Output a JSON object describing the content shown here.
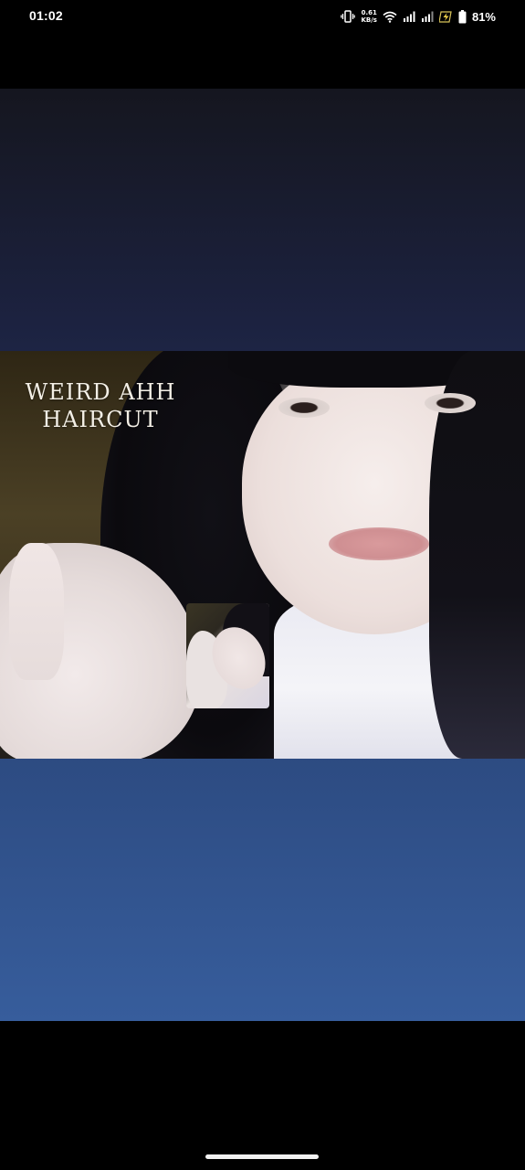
{
  "status_bar": {
    "time": "01:02",
    "net_speed_value": "0.61",
    "net_speed_unit": "KB/s",
    "battery_percent": "81%",
    "icons": [
      "vibrate-icon",
      "wifi-icon",
      "signal-icon",
      "signal-icon",
      "charging-icon",
      "battery-icon"
    ]
  },
  "video_call": {
    "overlay_caption_line1": "WEIRD AHH",
    "overlay_caption_line2": "HAIRCUT"
  },
  "colors": {
    "background_top": "#15161f",
    "background_bottom": "#375d9c",
    "caption_text": "#f3efe6"
  }
}
